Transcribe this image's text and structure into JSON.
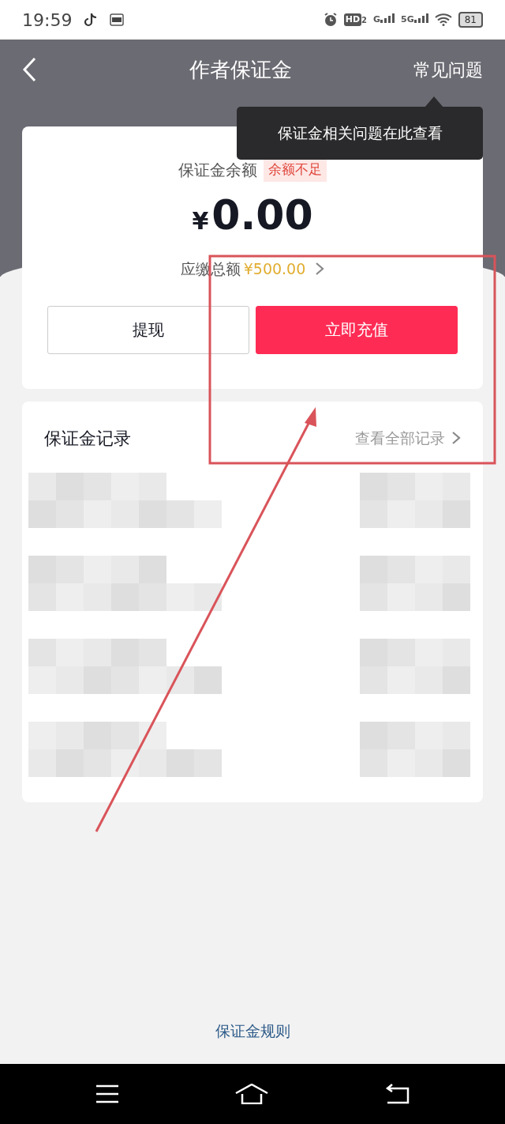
{
  "status_bar": {
    "time": "19:59",
    "hd_label": "HD",
    "hd_sub": "2",
    "signal_1_label": "G",
    "signal_2_label": "5G",
    "battery": "81"
  },
  "header": {
    "title": "作者保证金",
    "faq_link": "常见问题"
  },
  "tooltip": {
    "text": "保证金相关问题在此查看"
  },
  "balance_card": {
    "label": "保证金余额",
    "warning_tag": "余额不足",
    "currency": "¥",
    "amount": "0.00",
    "due_label": "应缴总额",
    "due_amount": "¥500.00",
    "buttons": [
      {
        "label": "提现",
        "kind": "outline"
      },
      {
        "label": "立即充值",
        "kind": "primary"
      }
    ]
  },
  "records": {
    "title": "保证金记录",
    "view_all": "查看全部记录"
  },
  "rules_link": "保证金规则"
}
